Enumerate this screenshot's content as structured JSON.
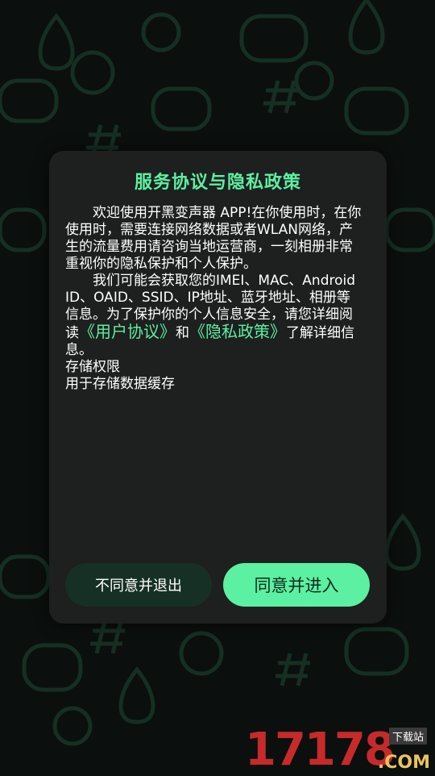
{
  "dialog": {
    "title": "服务协议与隐私政策",
    "paragraph1": "欢迎使用开黑变声器 APP!在你使用时，在你使用时，需要连接网络数据或者WLAN网络，产生的流量费用请咨询当地运营商，一刻相册非常重视你的隐私保护和个人保护。",
    "paragraph2_prefix": "我们可能会获取您的IMEI、MAC、Android ID、OAID、SSID、IP地址、蓝牙地址、相册等信息。为了保护你的个人信息安全，请您详细阅读",
    "user_agreement_link": "《用户协议》",
    "and_text": "和",
    "privacy_policy_link": "《隐私政策》",
    "paragraph2_suffix": "了解详细信息。",
    "permission_name": "存储权限",
    "permission_desc": "用于存储数据缓存",
    "decline_label": "不同意并退出",
    "accept_label": "同意并进入"
  },
  "watermark": {
    "digits": "17178",
    "domain": ".COM",
    "label": "下载站"
  },
  "colors": {
    "accent": "#5cf0a2",
    "modal_bg": "#1e1f1f",
    "decline_bg": "#173026",
    "page_bg": "#0b0f0d"
  }
}
